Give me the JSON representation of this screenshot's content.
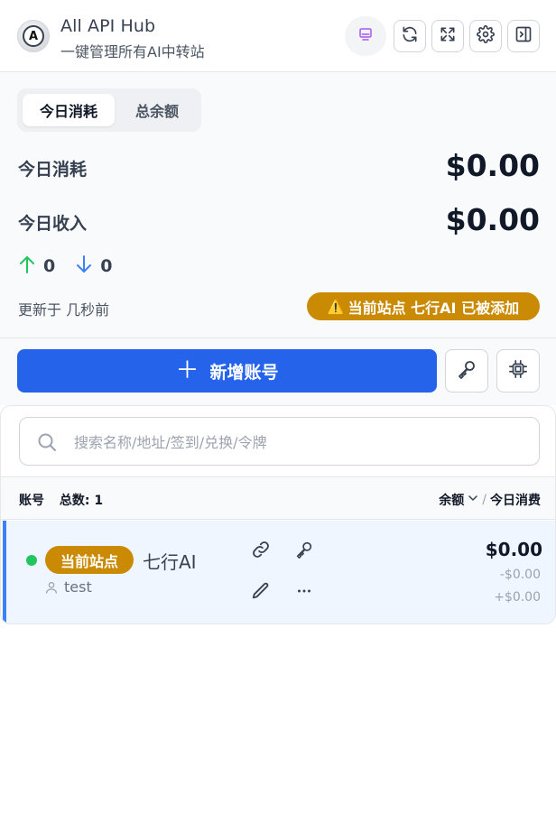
{
  "app": {
    "title": "All API Hub",
    "subtitle": "一键管理所有AI中转站",
    "logo_letter": "A"
  },
  "header_buttons": [
    {
      "name": "display-mode-icon",
      "active": true
    },
    {
      "name": "refresh-icon"
    },
    {
      "name": "expand-icon"
    },
    {
      "name": "gear-icon"
    },
    {
      "name": "sidebar-toggle-icon"
    }
  ],
  "stats": {
    "tabs": [
      "今日消耗",
      "总余额"
    ],
    "active_tab": 0,
    "consumption_label": "今日消耗",
    "consumption_value": "$0.00",
    "income_label": "今日收入",
    "income_value": "$0.00",
    "up_count": "0",
    "down_count": "0",
    "updated_text": "更新于 几秒前",
    "warning_text": "当前站点 七行AI 已被添加",
    "warning_icon": "⚠️"
  },
  "actions": {
    "add_account_label": "新增账号",
    "key_button_icon": "key-icon",
    "model_button_icon": "cpu-icon"
  },
  "account_list": {
    "search_placeholder": "搜索名称/地址/签到/兑换/令牌",
    "search_value": "",
    "column_account": "账号",
    "total_label": "总数: 1",
    "sort_balance": "余额",
    "sort_separator": "/",
    "sort_today": "今日消费",
    "rows": [
      {
        "status": "online",
        "badge": "当前站点",
        "site_name": "七行AI",
        "username": "test",
        "balance": "$0.00",
        "consumption": "-$0.00",
        "income": "+$0.00"
      }
    ]
  },
  "colors": {
    "primary": "#2563eb",
    "warning": "#ca8a04",
    "online": "#22c55e",
    "up_arrow": "#22c55e",
    "down_arrow": "#3b82f6",
    "accent_purple": "#a855f7"
  }
}
